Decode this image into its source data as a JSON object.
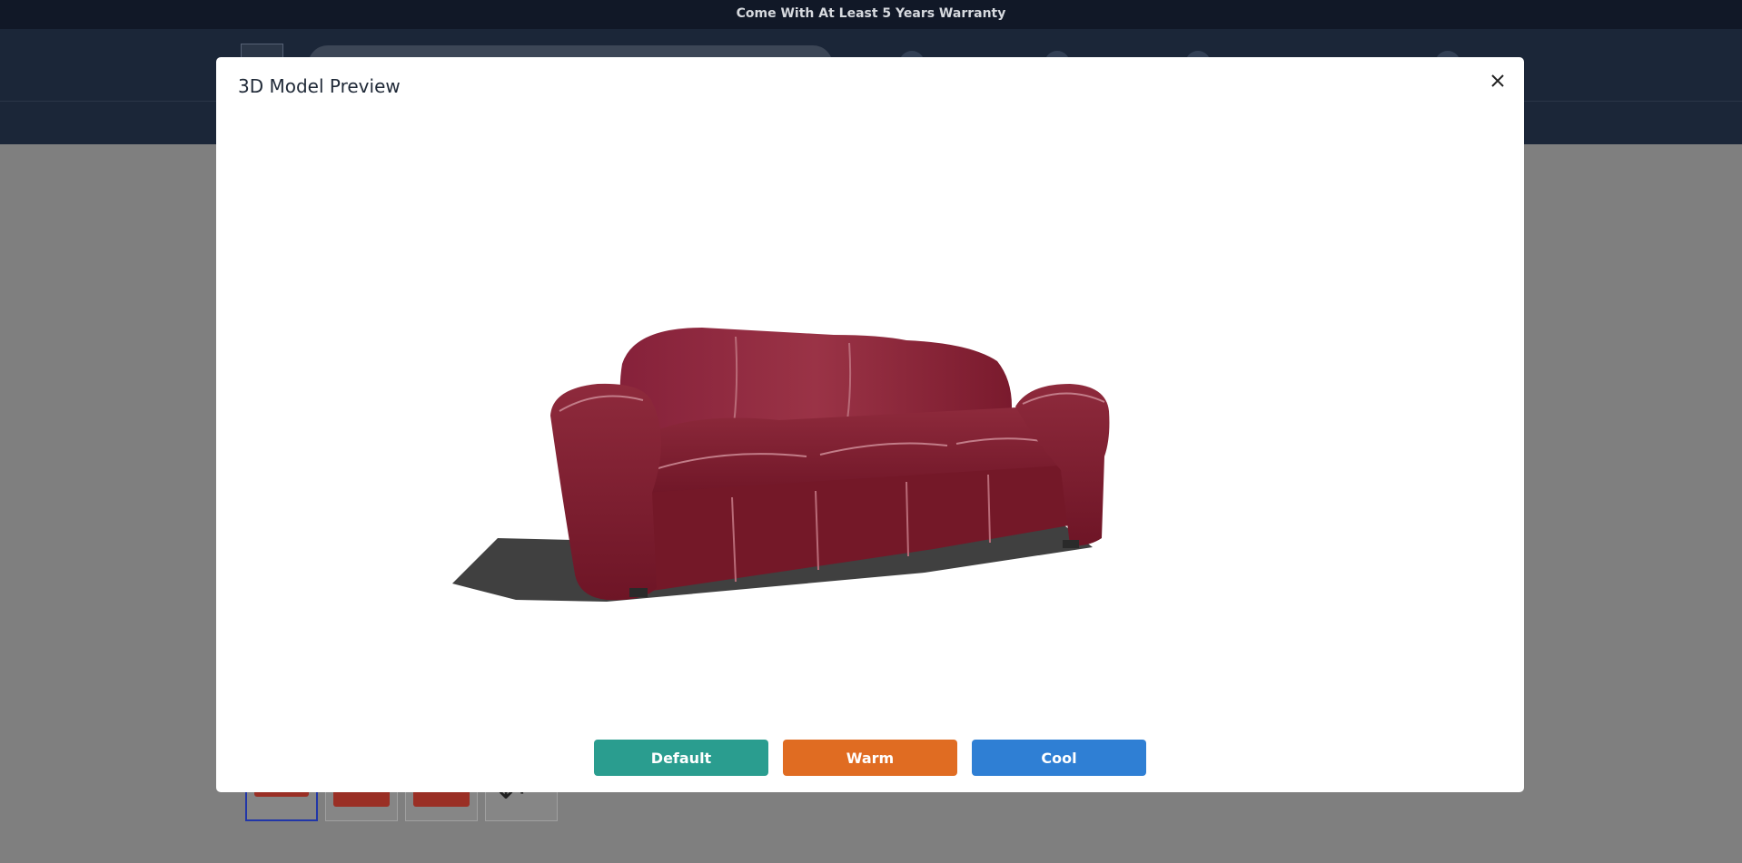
{
  "announcement": "Come With At Least 5 Years Warranty",
  "modal": {
    "title": "3D Model Preview",
    "close_icon": "close-icon",
    "model_subject": "red leather three-seat sofa",
    "buttons": [
      {
        "label": "Default",
        "color": "#2a9d8f"
      },
      {
        "label": "Warm",
        "color": "#e06c22"
      },
      {
        "label": "Cool",
        "color": "#2f7fd4"
      }
    ]
  },
  "colors": {
    "announcement_bg": "#111827",
    "header_bg": "#1b2638",
    "overlay": "#7f7f7f",
    "sofa": "#7c1a2c",
    "thumb_active_border": "#2136a8"
  },
  "gallery": {
    "thumbnail_count": 4,
    "active_index": 0,
    "last_thumb_icon": "rotate-3d-icon"
  }
}
